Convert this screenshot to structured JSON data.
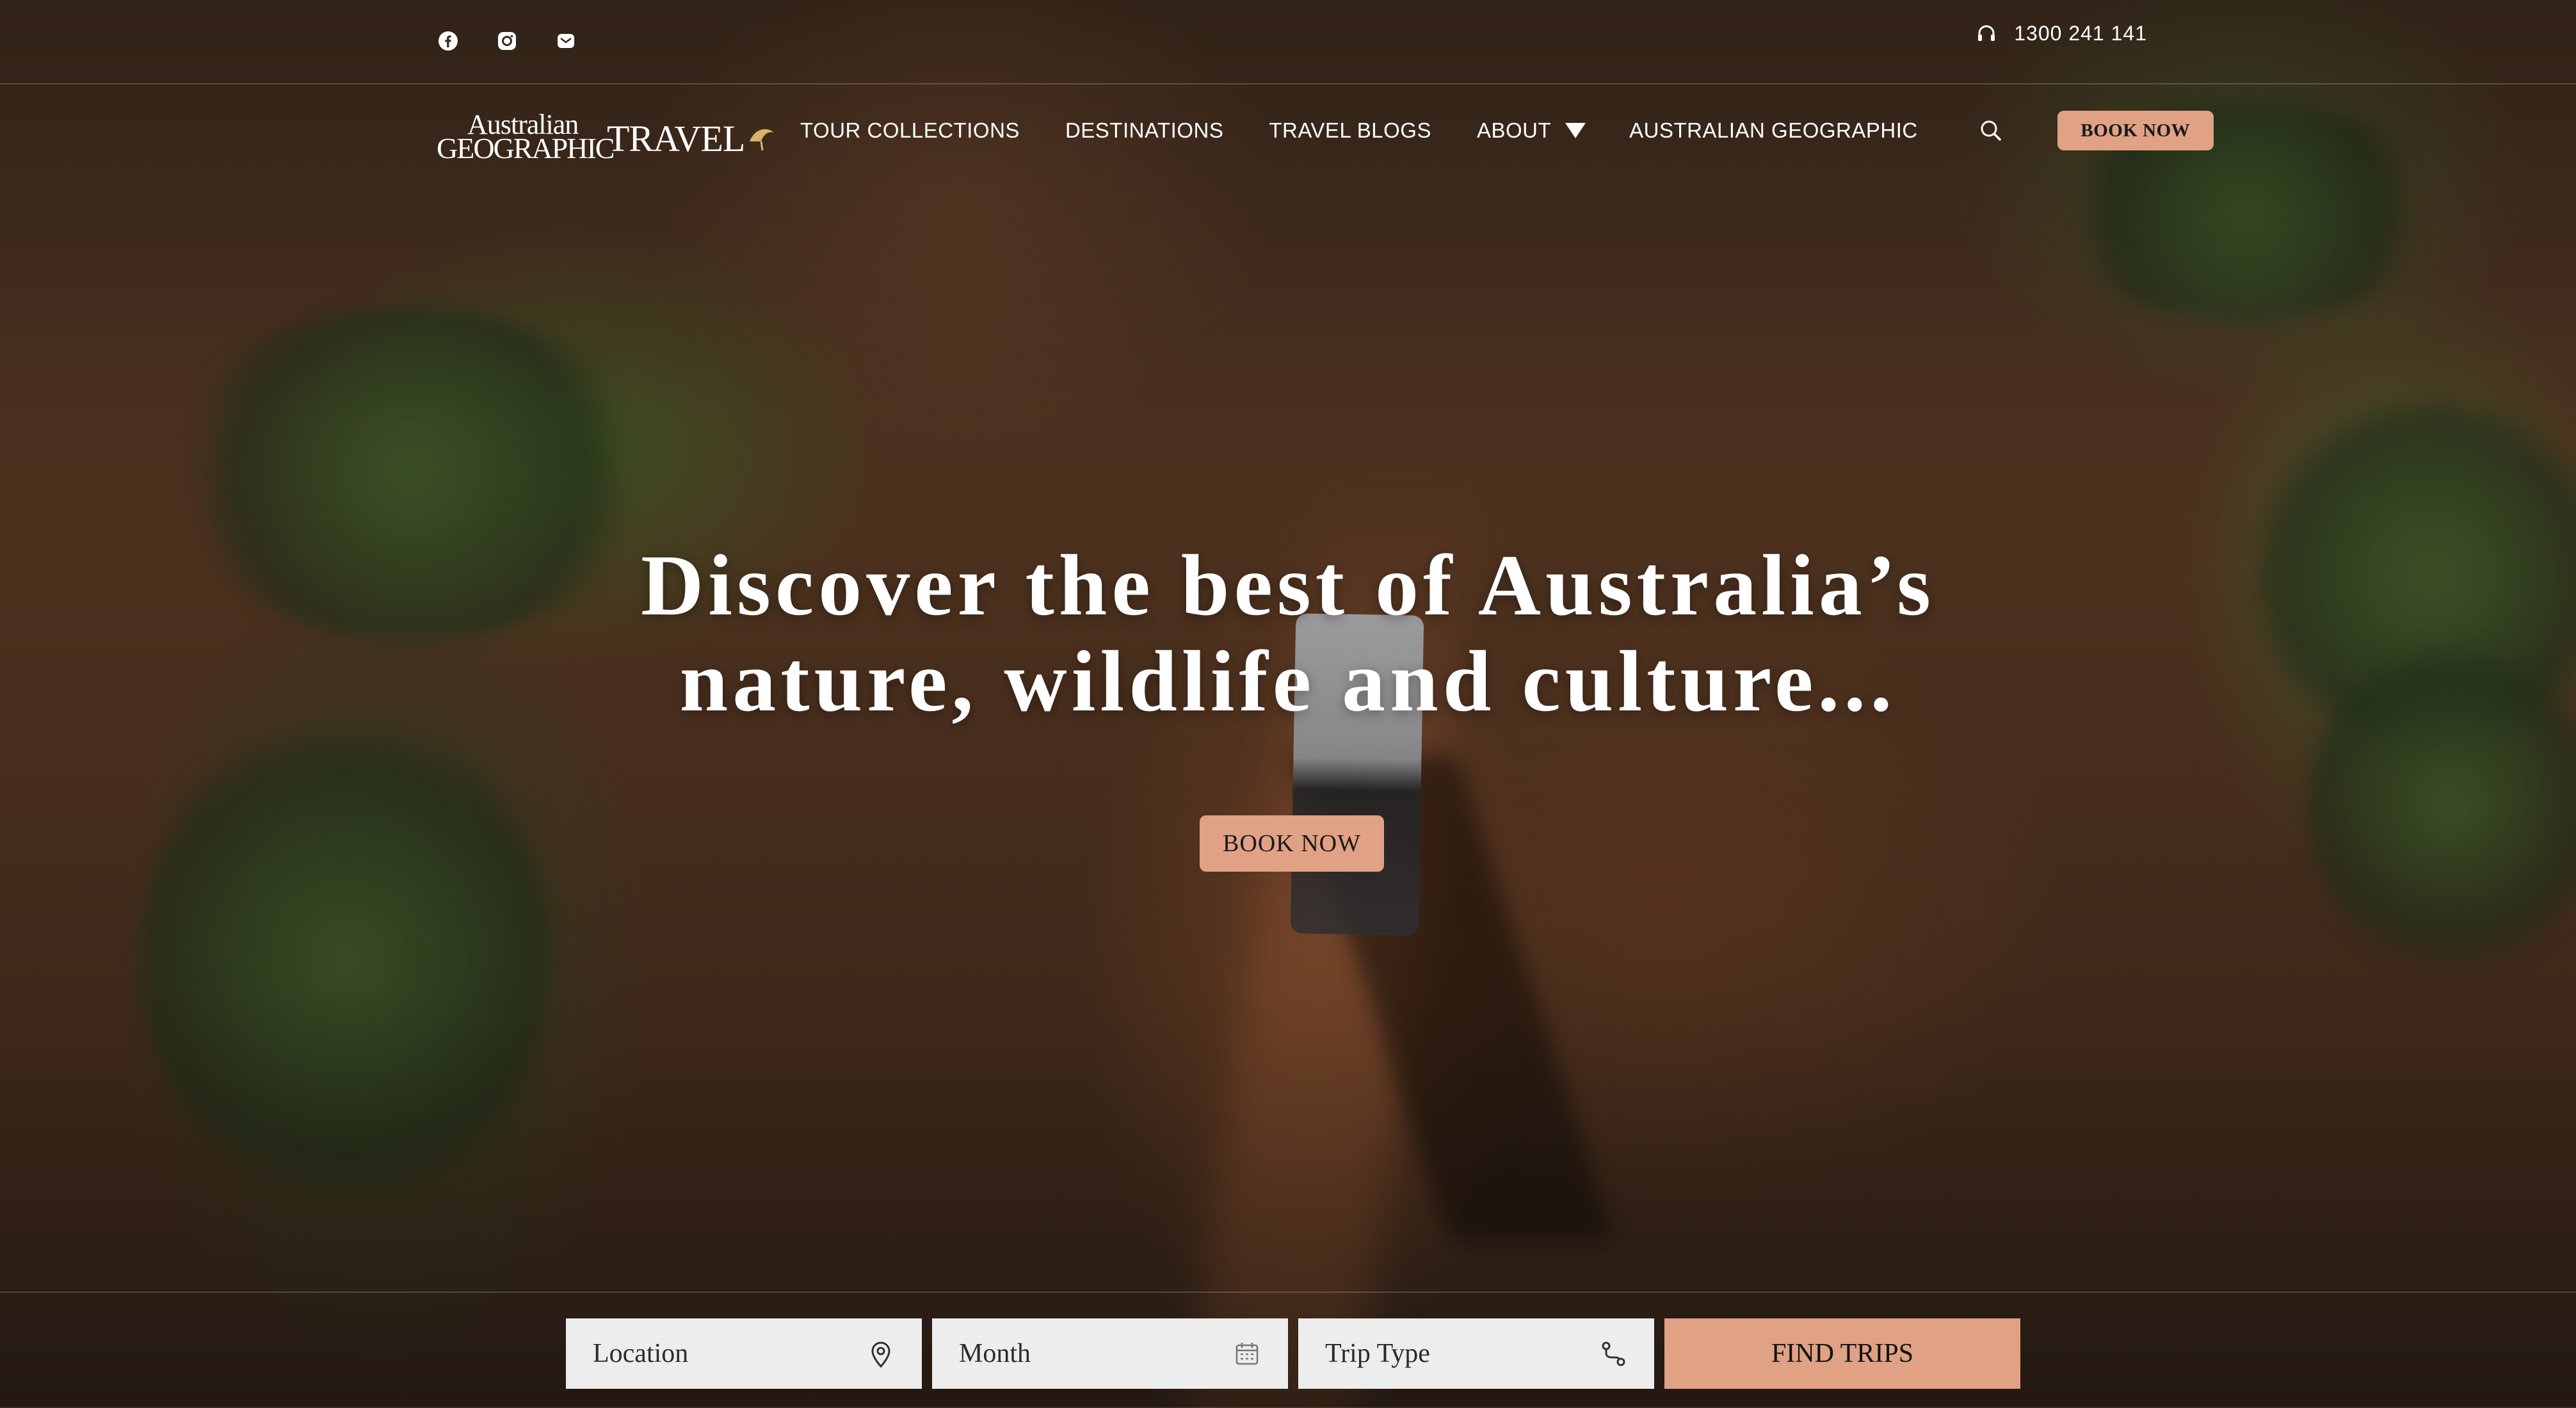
{
  "social": {
    "icons": [
      "facebook-icon",
      "instagram-icon",
      "mail-icon"
    ]
  },
  "contact": {
    "phone": "1300 241 141",
    "icon": "headset-icon"
  },
  "logo": {
    "line1": "Australian",
    "line2": "GEOGRAPHIC",
    "line3": "TRAVEL"
  },
  "nav": {
    "items": [
      "TOUR COLLECTIONS",
      "DESTINATIONS",
      "TRAVEL BLOGS",
      "ABOUT",
      "AUSTRALIAN GEOGRAPHIC"
    ],
    "book_label": "BOOK NOW"
  },
  "hero": {
    "title_line1": "Discover the best of Australia’s",
    "title_line2": "nature, wildlife and culture...",
    "book_label": "BOOK NOW"
  },
  "search": {
    "location_placeholder": "Location",
    "month_placeholder": "Month",
    "trip_type_placeholder": "Trip Type",
    "submit_label": "FIND TRIPS"
  },
  "colors": {
    "accent": "#e0a184",
    "field_bg": "#ededed"
  }
}
